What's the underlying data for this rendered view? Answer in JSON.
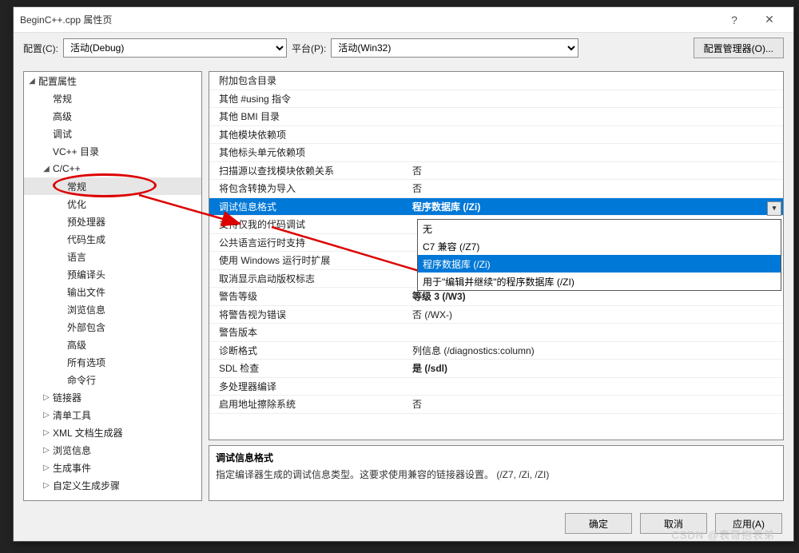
{
  "window": {
    "title": "BeginC++.cpp 属性页",
    "help": "?",
    "close": "✕"
  },
  "config": {
    "config_label": "配置(C):",
    "config_value": "活动(Debug)",
    "platform_label": "平台(P):",
    "platform_value": "活动(Win32)",
    "manager_button": "配置管理器(O)..."
  },
  "tree": [
    {
      "label": "配置属性",
      "exp": true,
      "depth": 0,
      "children": [
        {
          "label": "常规",
          "depth": 1
        },
        {
          "label": "高级",
          "depth": 1
        },
        {
          "label": "调试",
          "depth": 1
        },
        {
          "label": "VC++ 目录",
          "depth": 1
        },
        {
          "label": "C/C++",
          "exp": true,
          "depth": 1,
          "children": [
            {
              "label": "常规",
              "depth": 2,
              "sel": true
            },
            {
              "label": "优化",
              "depth": 2
            },
            {
              "label": "预处理器",
              "depth": 2
            },
            {
              "label": "代码生成",
              "depth": 2
            },
            {
              "label": "语言",
              "depth": 2
            },
            {
              "label": "预编译头",
              "depth": 2
            },
            {
              "label": "输出文件",
              "depth": 2
            },
            {
              "label": "浏览信息",
              "depth": 2
            },
            {
              "label": "外部包含",
              "depth": 2
            },
            {
              "label": "高级",
              "depth": 2
            },
            {
              "label": "所有选项",
              "depth": 2
            },
            {
              "label": "命令行",
              "depth": 2
            }
          ]
        },
        {
          "label": "链接器",
          "depth": 1,
          "col": true
        },
        {
          "label": "清单工具",
          "depth": 1,
          "col": true
        },
        {
          "label": "XML 文档生成器",
          "depth": 1,
          "col": true
        },
        {
          "label": "浏览信息",
          "depth": 1,
          "col": true
        },
        {
          "label": "生成事件",
          "depth": 1,
          "col": true
        },
        {
          "label": "自定义生成步骤",
          "depth": 1,
          "col": true
        }
      ]
    }
  ],
  "grid": [
    {
      "k": "附加包含目录",
      "v": ""
    },
    {
      "k": "其他 #using 指令",
      "v": ""
    },
    {
      "k": "其他 BMI 目录",
      "v": ""
    },
    {
      "k": "其他模块依赖项",
      "v": ""
    },
    {
      "k": "其他标头单元依赖项",
      "v": ""
    },
    {
      "k": "扫描源以查找模块依赖关系",
      "v": "否",
      "nm": true
    },
    {
      "k": "将包含转换为导入",
      "v": "否",
      "nm": true
    },
    {
      "k": "调试信息格式",
      "v": "程序数据库 (/Zi)",
      "sel": true,
      "dd": true
    },
    {
      "k": "支持仅我的代码调试",
      "v": ""
    },
    {
      "k": "公共语言运行时支持",
      "v": ""
    },
    {
      "k": "使用 Windows 运行时扩展",
      "v": ""
    },
    {
      "k": "取消显示启动版权标志",
      "v": ""
    },
    {
      "k": "警告等级",
      "v": "等级 3 (/W3)"
    },
    {
      "k": "将警告视为错误",
      "v": "否 (/WX-)",
      "nm": true
    },
    {
      "k": "警告版本",
      "v": ""
    },
    {
      "k": "诊断格式",
      "v": "列信息 (/diagnostics:column)",
      "nm": true
    },
    {
      "k": "SDL 检查",
      "v": "是 (/sdl)"
    },
    {
      "k": "多处理器编译",
      "v": ""
    },
    {
      "k": "启用地址擦除系统",
      "v": "否",
      "nm": true
    }
  ],
  "dropdown": {
    "options": [
      {
        "label": "无"
      },
      {
        "label": "C7 兼容 (/Z7)"
      },
      {
        "label": "程序数据库 (/Zi)",
        "on": true
      },
      {
        "label": "用于\"编辑并继续\"的程序数据库 (/ZI)"
      }
    ]
  },
  "desc": {
    "title": "调试信息格式",
    "body": "指定编译器生成的调试信息类型。这要求使用兼容的链接器设置。   (/Z7, /Zi, /ZI)"
  },
  "buttons": {
    "ok": "确定",
    "cancel": "取消",
    "apply": "应用(A)"
  },
  "watermark": "CSDN @表哥抱表弟"
}
